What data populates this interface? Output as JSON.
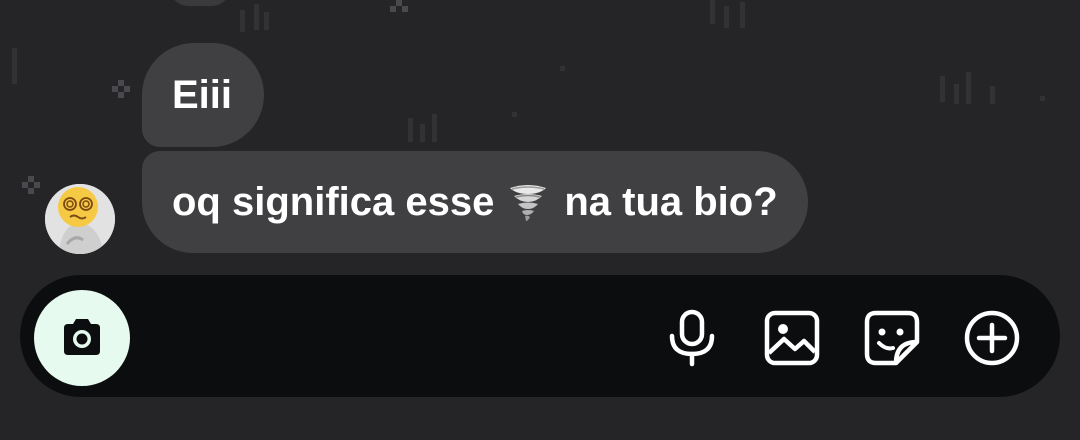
{
  "conversation": {
    "messages": [
      {
        "sender": "other",
        "text": "Eiii"
      },
      {
        "sender": "other",
        "text_before_emoji": "oq significa esse",
        "emoji": "tornado",
        "text_after_emoji": "na tua bio?"
      }
    ]
  },
  "composer": {
    "icons": {
      "camera": "camera-icon",
      "mic": "microphone-icon",
      "gallery": "image-icon",
      "sticker": "sticker-icon",
      "plus": "plus-circle-icon"
    }
  },
  "colors": {
    "background": "#252528",
    "bubble": "#404043",
    "composer": "#0b0d0f",
    "camera_button": "#e6faf0",
    "text": "#ffffff"
  }
}
